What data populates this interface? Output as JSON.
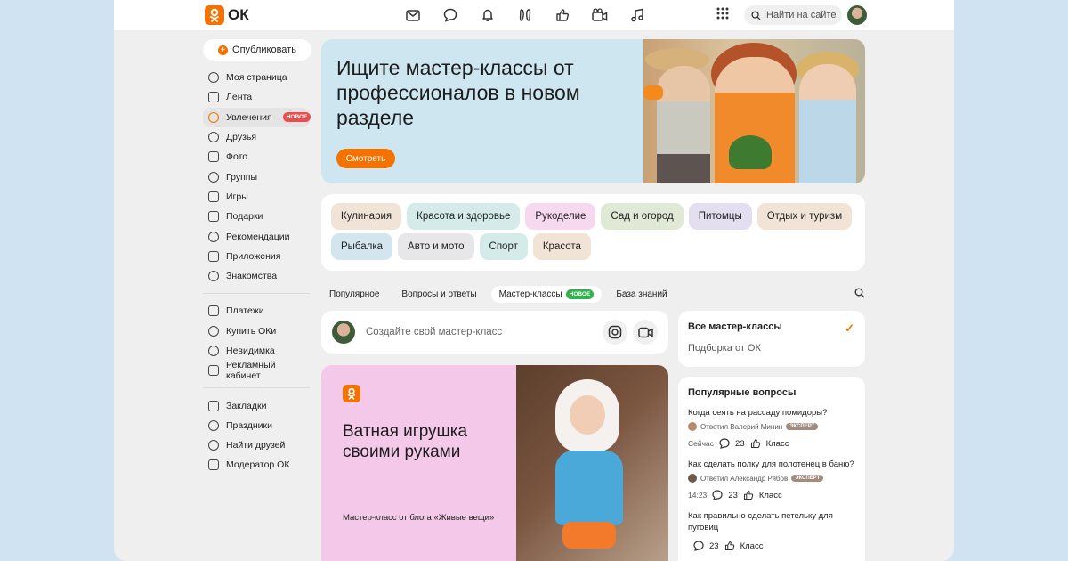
{
  "brand": {
    "logo_text": "ОК",
    "accent": "#f37200"
  },
  "topbar": {
    "icons": [
      "mail-icon",
      "chat-icon",
      "bell-icon",
      "guests-icon",
      "like-icon",
      "video-icon",
      "music-icon"
    ],
    "search_placeholder": "Найти на сайте"
  },
  "sidebar": {
    "publish_label": "Опубликовать",
    "items": [
      {
        "label": "Моя страница",
        "icon": "user-icon"
      },
      {
        "label": "Лента",
        "icon": "home-icon"
      },
      {
        "label": "Увлечения",
        "icon": "hobby-icon",
        "badge": "НОВОЕ"
      },
      {
        "label": "Друзья",
        "icon": "friends-icon"
      },
      {
        "label": "Фото",
        "icon": "photo-icon"
      },
      {
        "label": "Группы",
        "icon": "groups-icon"
      },
      {
        "label": "Игры",
        "icon": "games-icon"
      },
      {
        "label": "Подарки",
        "icon": "gift-icon"
      },
      {
        "label": "Рекомендации",
        "icon": "compass-icon"
      },
      {
        "label": "Приложения",
        "icon": "apps-icon"
      },
      {
        "label": "Знакомства",
        "icon": "dating-icon"
      }
    ],
    "items2": [
      {
        "label": "Платежи",
        "icon": "wallet-icon"
      },
      {
        "label": "Купить ОКи",
        "icon": "coin-icon"
      },
      {
        "label": "Невидимка",
        "icon": "invisible-icon"
      },
      {
        "label": "Рекламный кабинет",
        "icon": "ads-icon"
      }
    ],
    "items3": [
      {
        "label": "Закладки",
        "icon": "bookmark-icon"
      },
      {
        "label": "Праздники",
        "icon": "holiday-icon"
      },
      {
        "label": "Найти друзей",
        "icon": "add-friend-icon"
      },
      {
        "label": "Модератор ОК",
        "icon": "moderator-icon"
      }
    ]
  },
  "banner": {
    "title": "Ищите мастер-классы от профессионалов в новом разделе",
    "button": "Смотреть"
  },
  "categories": {
    "row1": [
      {
        "label": "Кулинария",
        "color": "#f1e3d6"
      },
      {
        "label": "Красота и здоровье",
        "color": "#d4ebea"
      },
      {
        "label": "Рукоделие",
        "color": "#f6d8ef"
      },
      {
        "label": "Сад и огород",
        "color": "#dfe9d6"
      },
      {
        "label": "Питомцы",
        "color": "#e4def1"
      },
      {
        "label": "Отдых и туризм",
        "color": "#f1e3d6"
      }
    ],
    "row2": [
      {
        "label": "Рыбалка",
        "color": "#d3e6ef"
      },
      {
        "label": "Авто и мото",
        "color": "#e7e7ea"
      },
      {
        "label": "Спорт",
        "color": "#d4ebea"
      },
      {
        "label": "Красота",
        "color": "#f1e3d6"
      }
    ]
  },
  "tabs": [
    {
      "label": "Популярное"
    },
    {
      "label": "Вопросы и ответы"
    },
    {
      "label": "Мастер-классы",
      "badge": "НОВОЕ",
      "selected": true
    },
    {
      "label": "База знаний"
    }
  ],
  "create": {
    "placeholder": "Создайте свой мастер-класс"
  },
  "card": {
    "title": "Ватная игрушка своими руками",
    "subtitle": "Мастер-класс от блога «Живые вещи»",
    "background": "#f3c8e8"
  },
  "right": {
    "all_title": "Все мастер-классы",
    "all_sub": "Подборка от ОК",
    "questions_title": "Популярные вопросы",
    "questions": [
      {
        "title": "Когда сеять на рассаду помидоры?",
        "author": "Ответил Валерий Минин",
        "badge": "ЭКСПЕРТ",
        "time": "Сейчас",
        "comments": "23",
        "klass": "Класс"
      },
      {
        "title": "Как сделать полку для полотенец в баню?",
        "author": "Ответил Александр Рябов",
        "badge": "ЭКСПЕРТ",
        "time": "14:23",
        "comments": "23",
        "klass": "Класс"
      },
      {
        "title": "Как правильно сделать петельку для пуговиц",
        "author": "",
        "badge": "",
        "time": "",
        "comments": "23",
        "klass": "Класс"
      }
    ]
  }
}
